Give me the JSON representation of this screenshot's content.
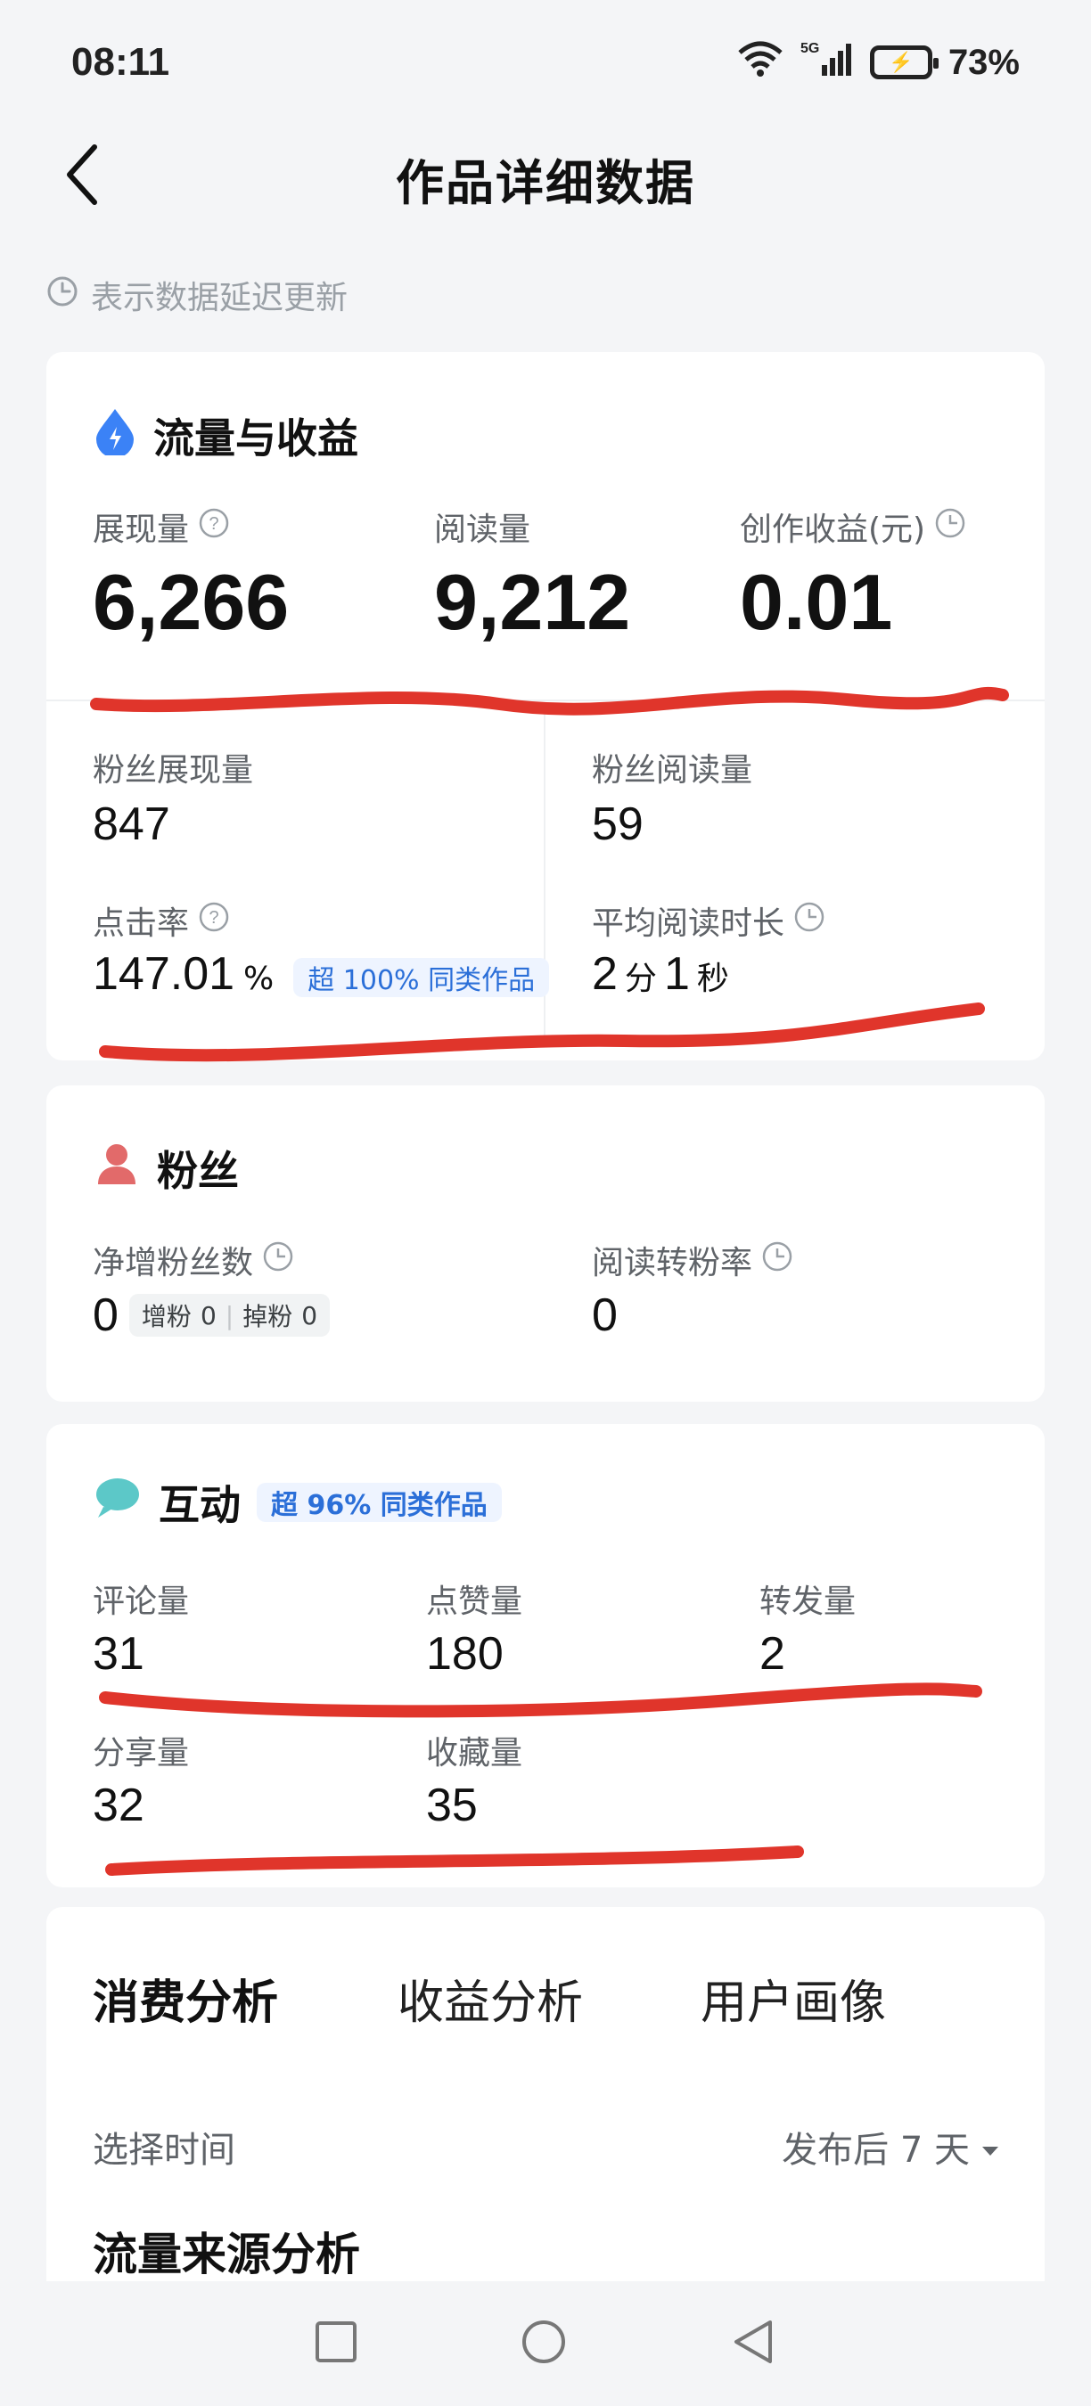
{
  "status_bar": {
    "time": "08:11",
    "battery_percent": "73%"
  },
  "header": {
    "title": "作品详细数据"
  },
  "notice": {
    "text": "表示数据延迟更新"
  },
  "traffic": {
    "title": "流量与收益",
    "impressions_label": "展现量",
    "impressions_value": "6,266",
    "reads_label": "阅读量",
    "reads_value": "9,212",
    "earnings_label": "创作收益(元)",
    "earnings_value": "0.01",
    "fan_impressions_label": "粉丝展现量",
    "fan_impressions_value": "847",
    "fan_reads_label": "粉丝阅读量",
    "fan_reads_value": "59",
    "ctr_label": "点击率",
    "ctr_value": "147.01",
    "ctr_unit": "%",
    "ctr_badge": "超 100% 同类作品",
    "avg_read_label": "平均阅读时长",
    "avg_read_min": "2",
    "avg_read_min_unit": "分",
    "avg_read_sec": "1",
    "avg_read_sec_unit": "秒"
  },
  "fans": {
    "title": "粉丝",
    "net_new_label": "净增粉丝数",
    "net_new_value": "0",
    "gain_label": "增粉",
    "gain_value": "0",
    "lose_label": "掉粉",
    "lose_value": "0",
    "conversion_label": "阅读转粉率",
    "conversion_value": "0"
  },
  "interaction": {
    "title": "互动",
    "badge": "超 96% 同类作品",
    "comments_label": "评论量",
    "comments_value": "31",
    "likes_label": "点赞量",
    "likes_value": "180",
    "reposts_label": "转发量",
    "reposts_value": "2",
    "shares_label": "分享量",
    "shares_value": "32",
    "favorites_label": "收藏量",
    "favorites_value": "35"
  },
  "tabs": [
    {
      "label": "消费分析"
    },
    {
      "label": "收益分析"
    },
    {
      "label": "用户画像"
    }
  ],
  "analysis": {
    "select_time_label": "选择时间",
    "select_time_value": "发布后 7 天",
    "source_title": "流量来源分析"
  },
  "colors": {
    "accent_red": "#e05a55",
    "badge_blue": "#2b6fd8",
    "badge_bg": "#eef4ff"
  }
}
